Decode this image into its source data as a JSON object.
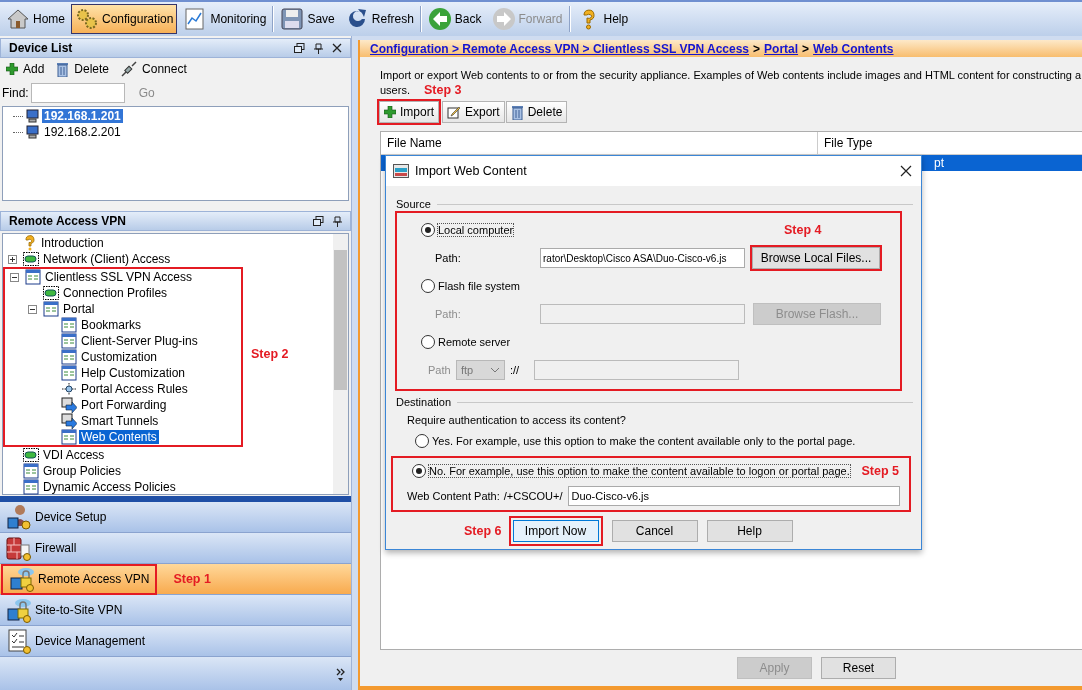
{
  "toolbar": [
    {
      "label": "Home",
      "selected": false,
      "disabled": false
    },
    {
      "label": "Configuration",
      "selected": true,
      "disabled": false
    },
    {
      "label": "Monitoring",
      "selected": false,
      "disabled": false
    },
    {
      "label": "Save",
      "selected": false,
      "disabled": false
    },
    {
      "label": "Refresh",
      "selected": false,
      "disabled": false
    },
    {
      "label": "Back",
      "selected": false,
      "disabled": false
    },
    {
      "label": "Forward",
      "selected": false,
      "disabled": true
    },
    {
      "label": "Help",
      "selected": false,
      "disabled": false
    }
  ],
  "device_list": {
    "title": "Device List",
    "actions": [
      "Add",
      "Delete",
      "Connect"
    ],
    "find_label": "Find:",
    "go_label": "Go",
    "devices": [
      {
        "label": "192.168.1.201",
        "selected": true
      },
      {
        "label": "192.168.2.201",
        "selected": false
      }
    ]
  },
  "remote_access_panel": {
    "title": "Remote Access VPN",
    "tree": [
      {
        "label": "Introduction",
        "kind": "help",
        "selected": false
      },
      {
        "label": "Network (Client) Access",
        "kind": "connector",
        "selected": false,
        "expanded": false
      },
      {
        "label": "Clientless SSL VPN Access",
        "kind": "page",
        "selected": false,
        "expanded": true,
        "callout": "Step 2",
        "children": [
          {
            "label": "Connection Profiles",
            "kind": "connector",
            "selected": false
          },
          {
            "label": "Portal",
            "kind": "page",
            "selected": false,
            "expanded": true,
            "children": [
              {
                "label": "Bookmarks",
                "kind": "page",
                "selected": false
              },
              {
                "label": "Client-Server Plug-ins",
                "kind": "page",
                "selected": false
              },
              {
                "label": "Customization",
                "kind": "page",
                "selected": false
              },
              {
                "label": "Help Customization",
                "kind": "page",
                "selected": false
              },
              {
                "label": "Portal Access Rules",
                "kind": "rule",
                "selected": false
              },
              {
                "label": "Port Forwarding",
                "kind": "forward",
                "selected": false
              },
              {
                "label": "Smart Tunnels",
                "kind": "forward",
                "selected": false
              },
              {
                "label": "Web Contents",
                "kind": "page",
                "selected": true
              }
            ]
          }
        ]
      },
      {
        "label": "VDI Access",
        "kind": "connector",
        "selected": false
      },
      {
        "label": "Group Policies",
        "kind": "page",
        "selected": false
      },
      {
        "label": "Dynamic Access Policies",
        "kind": "page",
        "selected": false
      }
    ]
  },
  "nav": [
    {
      "label": "Device Setup",
      "selected": false
    },
    {
      "label": "Firewall",
      "selected": false
    },
    {
      "label": "Remote Access VPN",
      "selected": true,
      "callout": "Step 1"
    },
    {
      "label": "Site-to-Site VPN",
      "selected": false
    },
    {
      "label": "Device Management",
      "selected": false
    }
  ],
  "content": {
    "breadcrumb": [
      {
        "text": "Configuration > Remote Access VPN > Clientless SSL VPN Access",
        "kind": "link"
      },
      {
        "text": ">",
        "kind": "separator"
      },
      {
        "text": "Portal",
        "kind": "link"
      },
      {
        "text": ">",
        "kind": "separator"
      },
      {
        "text": "Web Contents",
        "kind": "link"
      }
    ],
    "description_lines": [
      "Import or export Web contents to or from the security appliance. Examples of Web contents include images and HTML content for constructing a",
      "users."
    ],
    "actions": [
      {
        "label": "Import",
        "callout": "Step 3"
      },
      {
        "label": "Export"
      },
      {
        "label": "Delete"
      }
    ],
    "table": {
      "columns": [
        "File Name",
        "File Type"
      ],
      "rows": [
        {
          "file_type": "pt",
          "selected": true
        }
      ]
    },
    "footer_buttons": [
      {
        "label": "Apply",
        "disabled": true
      },
      {
        "label": "Reset",
        "disabled": false
      }
    ]
  },
  "dialog": {
    "title": "Import Web Content",
    "source": {
      "legend": "Source",
      "framed": true,
      "options": [
        {
          "label": "Local computer",
          "selected": true,
          "path_label": "Path:",
          "path_value": "rator\\Desktop\\Cisco ASA\\Duo-Cisco-v6.js",
          "disabled": false,
          "button": {
            "label": "Browse Local Files...",
            "callout": "Step 4"
          }
        },
        {
          "label": "Flash file system",
          "selected": false,
          "path_label": "Path:",
          "disabled": true,
          "button": {
            "label": "Browse Flash..."
          }
        },
        {
          "label": "Remote server",
          "selected": false,
          "path_label": "Path",
          "protocol": "ftp",
          "separator": "://",
          "disabled": true
        }
      ]
    },
    "destination": {
      "legend": "Destination",
      "question": "Require authentication to access its content?",
      "options": [
        {
          "label": "Yes. For example, use this option to make the content available only to the portal page.",
          "selected": false
        },
        {
          "label": "No. For example, use this option to make the content available to logon or portal page.",
          "selected": true,
          "callout": "Step 5",
          "path_label": "Web Content Path:",
          "path_prefix": "/+CSCOU+/",
          "path_value": "Duo-Cisco-v6.js"
        }
      ]
    },
    "buttons": [
      {
        "label": "Import Now",
        "default": true,
        "callout": "Step 6"
      },
      {
        "label": "Cancel",
        "default": false
      },
      {
        "label": "Help",
        "default": false
      }
    ]
  }
}
